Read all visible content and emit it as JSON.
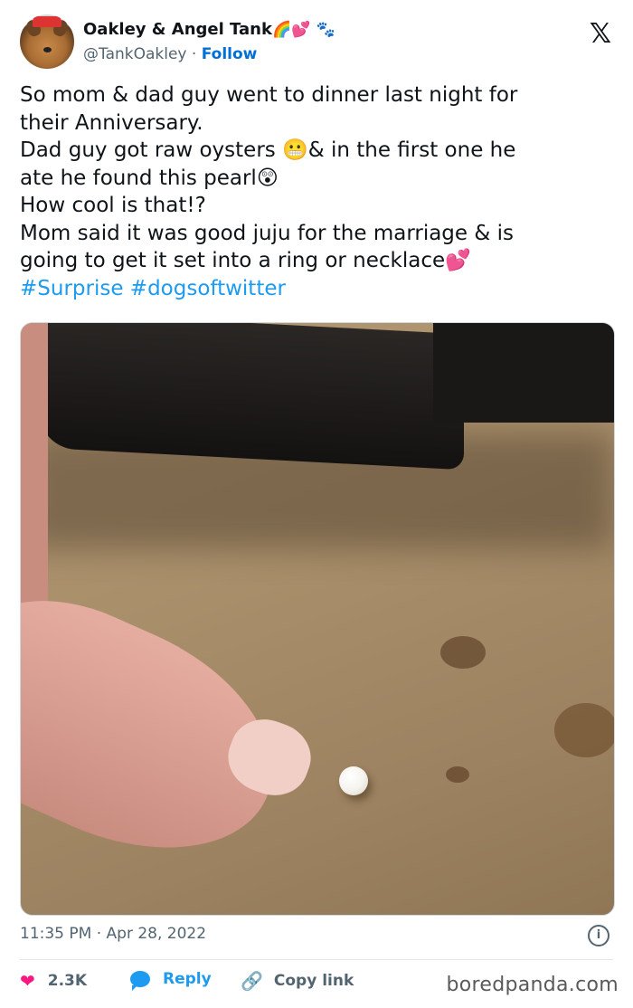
{
  "author": {
    "name": "Oakley & Angel Tank",
    "name_emojis": [
      "🌈",
      "💕",
      "🐾"
    ],
    "handle": "@TankOakley",
    "separator": "·",
    "follow_label": "Follow"
  },
  "platform_icon": "x-logo-icon",
  "post": {
    "lines": [
      "So mom & dad guy went to dinner last night for",
      "their Anniversary.",
      "Dad guy got raw oysters 😬& in the first one he",
      "ate he found this pearl😲",
      "How cool is that!?",
      "Mom said it was good juju for the marriage & is",
      "going to get it set into a ring or necklace💕"
    ],
    "hashtags": "#Surprise #dogsoftwitter"
  },
  "timestamp": "11:35 PM · Apr 28, 2022",
  "actions": {
    "likes": "2.3K",
    "reply_label": "Reply",
    "copy_link_label": "Copy link"
  },
  "watermark": "boredpanda.com",
  "colors": {
    "accent": "#1d9bf0",
    "follow": "#006fd6",
    "like": "#f91880",
    "secondary_text": "#536471"
  }
}
